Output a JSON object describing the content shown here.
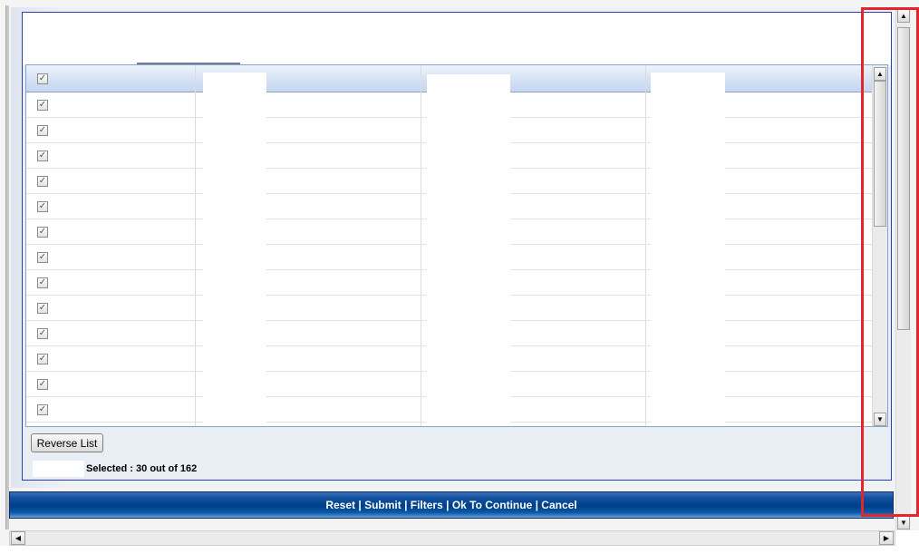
{
  "grid": {
    "header_checked": true,
    "rows_checked": [
      true,
      true,
      true,
      true,
      true,
      true,
      true,
      true,
      true,
      true,
      true,
      true,
      true
    ]
  },
  "footer": {
    "reverse_label": "Reverse List",
    "selected_text": "Selected : 30 out of 162"
  },
  "actions": {
    "reset": "Reset",
    "submit": "Submit",
    "filters": "Filters",
    "ok": "Ok To Continue",
    "cancel": "Cancel",
    "separator": " | "
  },
  "scroll": {
    "grid_vertical_position": 0,
    "page_vertical_position": 0
  },
  "icons": {
    "checkbox": "check-icon",
    "up": "arrow-up-icon",
    "down": "arrow-down-icon",
    "left": "arrow-left-icon",
    "right": "arrow-right-icon"
  },
  "colors": {
    "action_bar": "#003f88",
    "highlight": "#e3262b",
    "border": "#2b3fae"
  }
}
